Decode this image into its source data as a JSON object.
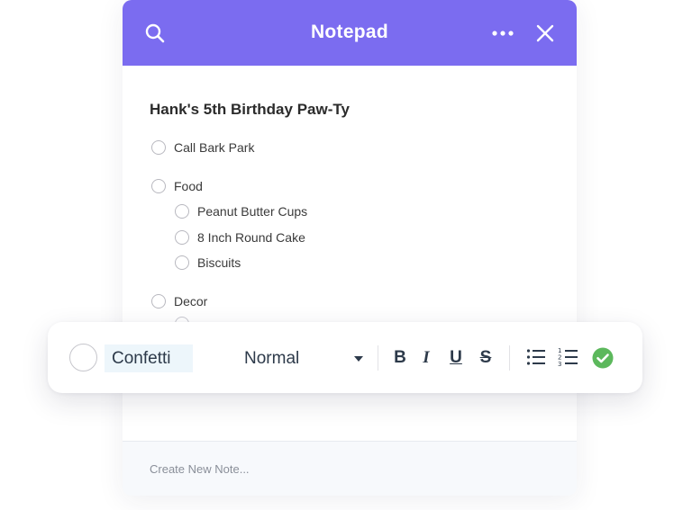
{
  "header": {
    "title": "Notepad",
    "icons": {
      "search": "search-icon",
      "more": "more-dots-icon",
      "close": "close-icon"
    },
    "color": "#7b6cf0"
  },
  "note": {
    "title": "Hank's 5th Birthday Paw-Ty",
    "items": [
      {
        "label": "Call Bark Park",
        "checked": false
      },
      {
        "label": "Food",
        "checked": false,
        "children": [
          {
            "label": "Peanut Butter Cups",
            "checked": false
          },
          {
            "label": "8 Inch Round Cake",
            "checked": false
          },
          {
            "label": "Biscuits",
            "checked": false
          }
        ]
      },
      {
        "label": "Decor",
        "checked": false
      }
    ]
  },
  "toolbar": {
    "input_value": "Confetti",
    "text_style": "Normal",
    "bold": "B",
    "italic": "I",
    "underline": "U",
    "strike": "S",
    "icons": {
      "bullet_list": "bullet-list-icon",
      "numbered_list": "numbered-list-icon",
      "confirm": "check-circle-icon"
    },
    "confirm_color": "#5cb85c"
  },
  "footer": {
    "placeholder": "Create New Note..."
  }
}
